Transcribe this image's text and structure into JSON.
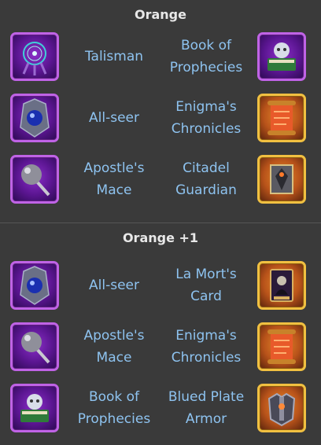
{
  "sections": [
    {
      "title": "Orange",
      "rows": [
        {
          "left": {
            "label": "Talisman",
            "icon": "dreamcatcher-talisman-icon",
            "rarity": "purple"
          },
          "right": {
            "label": "Book of Prophecies",
            "icon": "book-of-prophecies-icon",
            "rarity": "purple"
          }
        },
        {
          "left": {
            "label": "All-seer",
            "icon": "all-seer-orb-icon",
            "rarity": "purple"
          },
          "right": {
            "label": "Enigma's Chronicles",
            "icon": "scroll-icon",
            "rarity": "gold"
          }
        },
        {
          "left": {
            "label": "Apostle's Mace",
            "icon": "mace-icon",
            "rarity": "purple"
          },
          "right": {
            "label": "Citadel Guardian",
            "icon": "citadel-guardian-icon",
            "rarity": "gold"
          }
        }
      ]
    },
    {
      "title": "Orange +1",
      "rows": [
        {
          "left": {
            "label": "All-seer",
            "icon": "all-seer-orb-icon",
            "rarity": "purple"
          },
          "right": {
            "label": "La Mort's Card",
            "icon": "death-card-icon",
            "rarity": "gold"
          }
        },
        {
          "left": {
            "label": "Apostle's Mace",
            "icon": "mace-icon",
            "rarity": "purple"
          },
          "right": {
            "label": "Enigma's Chronicles",
            "icon": "scroll-icon",
            "rarity": "gold"
          }
        },
        {
          "left": {
            "label": "Book of Prophecies",
            "icon": "book-of-prophecies-icon",
            "rarity": "purple"
          },
          "right": {
            "label": "Blued Plate Armor",
            "icon": "plate-armor-icon",
            "rarity": "gold"
          }
        }
      ]
    }
  ],
  "colors": {
    "background": "#3a3a3a",
    "title": "#e8e8e8",
    "label": "#8ec3f0",
    "purple_frame": "#c063e6",
    "gold_frame": "#f1c041"
  }
}
